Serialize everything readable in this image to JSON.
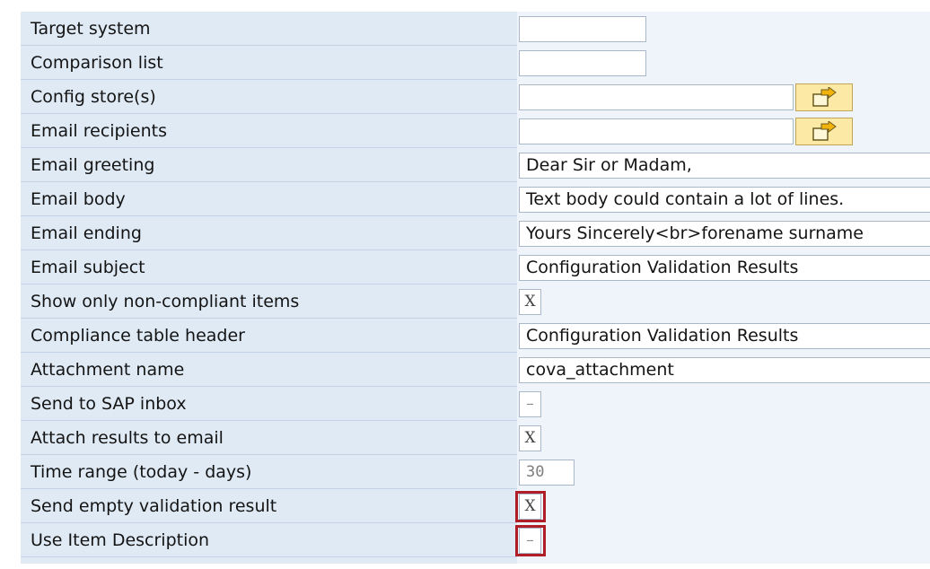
{
  "form": {
    "rows": [
      {
        "label": "Target system",
        "value": ""
      },
      {
        "label": "Comparison list",
        "value": ""
      },
      {
        "label": "Config store(s)",
        "value": ""
      },
      {
        "label": "Email recipients",
        "value": ""
      },
      {
        "label": "Email greeting",
        "value": "Dear Sir or Madam,"
      },
      {
        "label": "Email body",
        "value": "Text body could contain a lot of lines."
      },
      {
        "label": "Email ending",
        "value": "Yours Sincerely<br>forename surname"
      },
      {
        "label": "Email subject",
        "value": "Configuration Validation Results"
      },
      {
        "label": "Show only non-compliant items",
        "value": "X"
      },
      {
        "label": "Compliance table header",
        "value": "Configuration Validation Results"
      },
      {
        "label": "Attachment name",
        "value": "cova_attachment"
      },
      {
        "label": "Send to SAP inbox",
        "value": "–"
      },
      {
        "label": "Attach results to email",
        "value": "X"
      },
      {
        "label": "Time range (today - days)",
        "value": "30"
      },
      {
        "label": "Send empty validation result",
        "value": "X"
      },
      {
        "label": "Use Item Description",
        "value": "–"
      }
    ]
  },
  "icons": {
    "multiple_selection": "multiple-selection-arrow-icon"
  },
  "colors": {
    "label_bg": "#dfeaf5",
    "button_bg": "#fbe9a5",
    "highlight": "#b01e28"
  }
}
